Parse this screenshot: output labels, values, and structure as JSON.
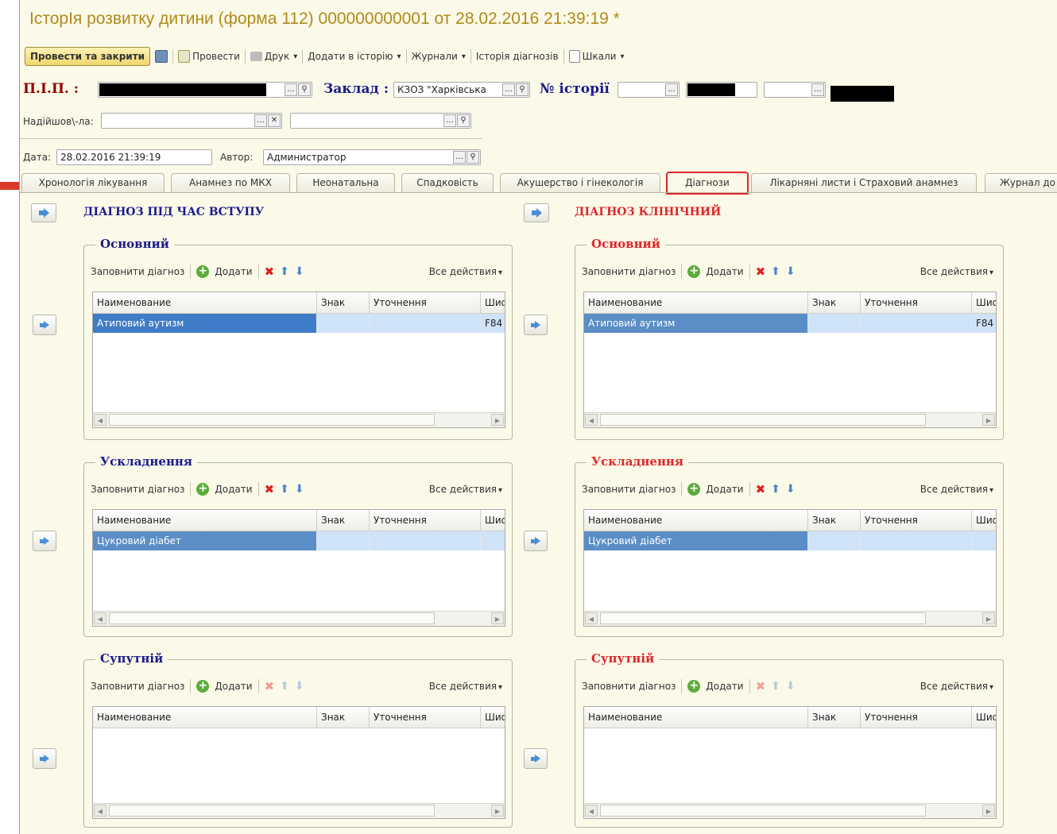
{
  "window": {
    "title": "ІсторІя розвитку дитини (форма 112) 000000000001 от 28.02.2016 21:39:19 *"
  },
  "toolbar": {
    "post_close": "Провести та закрити",
    "post": "Провести",
    "print": "Друк",
    "add_history": "Додати в історію",
    "journals": "Журнали",
    "diag_history": "Історія діагнозів",
    "scales": "Шкали"
  },
  "header": {
    "pib_label": "П.І.П. :",
    "zaklad_label": "Заклад :",
    "zaklad_value": "КЗОЗ \"Харківська",
    "history_label": "№ історії",
    "arrived_label": "Надійшов\\-ла:",
    "date_label": "Дата:",
    "date_value": "28.02.2016 21:39:19",
    "author_label": "Автор:",
    "author_value": "Администратор",
    "ellipsis": "...",
    "ellipsis_q": "...",
    "ellipsis_x": "..."
  },
  "tabs": [
    "Хронологія лікування",
    "Анамнез по МКХ",
    "Неонатальна",
    "Спадковість",
    "Акушерство і гінекологія",
    "Діагнози",
    "Лікарняні листи і Страховий анамнез",
    "Журнал до"
  ],
  "left_col": {
    "title": "ДІАГНОЗ ПІД ЧАС ВСТУПУ"
  },
  "right_col": {
    "title": "ДІАГНОЗ КЛІНІЧНИЙ"
  },
  "groups": {
    "main": "Основний",
    "compl": "Ускладнення",
    "concom": "Супутній"
  },
  "gtb": {
    "fill": "Заповнити діагноз",
    "add": "Додати",
    "all": "Все действия"
  },
  "cols": {
    "name": "Наименование",
    "sign": "Знак",
    "spec": "Уточнення",
    "code": "Шифр"
  },
  "rows": {
    "main_name": "Атиповий аутизм",
    "main_code": "F84",
    "compl_name": "Цукровий діабет"
  },
  "colors": {
    "accent_red": "#e0262a",
    "title_gold": "#b08a1a",
    "dark_blue": "#1a1a8c",
    "dark_red": "#8b0000"
  }
}
